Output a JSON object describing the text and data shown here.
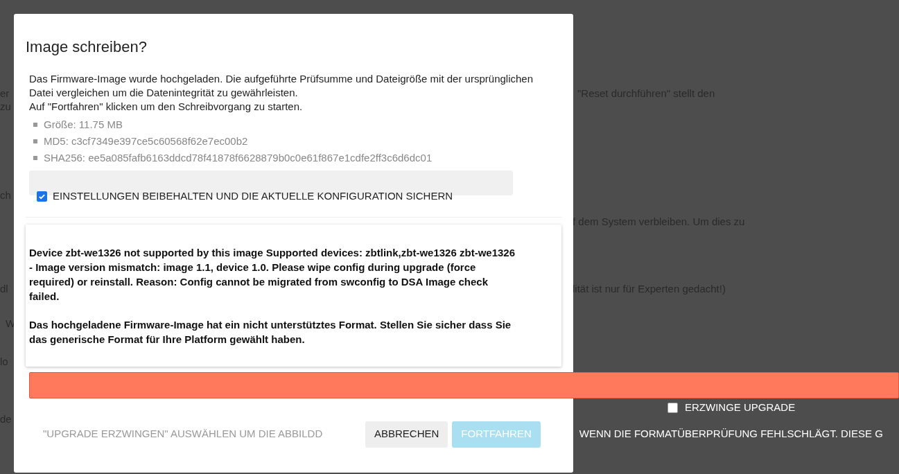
{
  "background_text": [
    {
      "text": "er"
    },
    {
      "text": "zu"
    },
    {
      "text": "ch"
    },
    {
      "text": "dl"
    },
    {
      "text": "W"
    },
    {
      "text": "lo"
    },
    {
      "text": "de"
    },
    {
      "text": "\"Reset durchführen\" stellt den"
    },
    {
      "text": "f dem System verbleiben. Um dies zu"
    },
    {
      "text": "lität ist nur für Experten gedacht!)"
    }
  ],
  "dialog": {
    "title": "Image schreiben?",
    "intro": [
      "Das Firmware-Image wurde hochgeladen. Die aufgeführte Prüfsumme und Dateigröße mit der ursprünglichen Datei vergleichen um die Datenintegrität zu gewährleisten.",
      "Auf \"Fortfahren\" klicken um den Schreibvorgang zu starten."
    ],
    "details": [
      "Größe: 11.75 MB",
      "MD5: c3cf7349e397ce5c60568f62e7ec00b2",
      "SHA256: ee5a085fafb6163ddcd78f41878f6628879b0c0e61f867e1cdfe2ff3c6d6dc01"
    ],
    "keep_settings": {
      "label": "EINSTELLUNGEN BEIBEHALTEN UND DIE AKTUELLE KONFIGURATION SICHERN",
      "checked": true
    },
    "errors": [
      "Device zbt-we1326 not supported by this image Supported devices: zbtlink,zbt-we1326 zbt-we1326 - Image version mismatch: image 1.1, device 1.0. Please wipe config during upgrade (force required) or reinstall. Reason: Config cannot be migrated from swconfig to DSA Image check failed.",
      "Das hochgeladene Firmware-Image hat ein nicht unterstütztes Format. Stellen Sie sicher dass Sie das generische Format für Ihre Platform gewählt haben."
    ],
    "force_upgrade": {
      "label": "ERZWINGE UPGRADE",
      "checked": false
    },
    "force_hint": [
      "\"UPGRADE ERZWINGEN\" AUSWÄHLEN UM DIE ABBILDD",
      "WENN DIE FORMATÜBERPRÜFUNG FEHLSCHLÄGT. DIESE G"
    ],
    "buttons": [
      {
        "label": "ABBRECHEN",
        "kind": "cancel",
        "disabled": false
      },
      {
        "label": "FORTFAHREN",
        "kind": "primary",
        "disabled": true
      }
    ]
  }
}
